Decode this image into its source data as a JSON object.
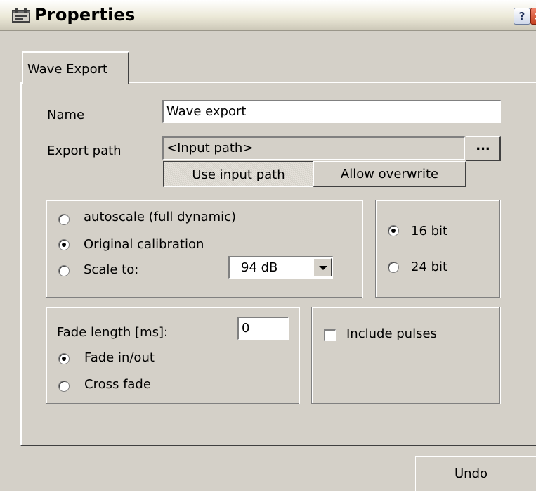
{
  "window": {
    "title": "Properties",
    "help_label": "?",
    "close_label": "×",
    "icon": "properties-app-icon"
  },
  "tabs": [
    {
      "label": "Wave Export",
      "active": true
    }
  ],
  "form": {
    "name_label": "Name",
    "name_value": "Wave export",
    "export_path_label": "Export path",
    "export_path_value": "<Input path>",
    "browse_label": "...",
    "use_input_path_label": "Use input path",
    "use_input_path_pressed": true,
    "allow_overwrite_label": "Allow overwrite"
  },
  "scaling": {
    "options": [
      {
        "label": "autoscale (full dynamic)",
        "checked": false
      },
      {
        "label": "Original calibration",
        "checked": true
      },
      {
        "label": "Scale to:",
        "checked": false
      }
    ],
    "scale_value": "94 dB"
  },
  "bit_depth": {
    "options": [
      {
        "label": "16 bit",
        "checked": true
      },
      {
        "label": "24 bit",
        "checked": false
      }
    ]
  },
  "fade": {
    "length_label": "Fade length [ms]:",
    "length_value": "0",
    "options": [
      {
        "label": "Fade in/out",
        "checked": true
      },
      {
        "label": "Cross fade",
        "checked": false
      }
    ]
  },
  "pulses": {
    "label": "Include pulses",
    "checked": false
  },
  "footer": {
    "undo_label": "Undo"
  }
}
